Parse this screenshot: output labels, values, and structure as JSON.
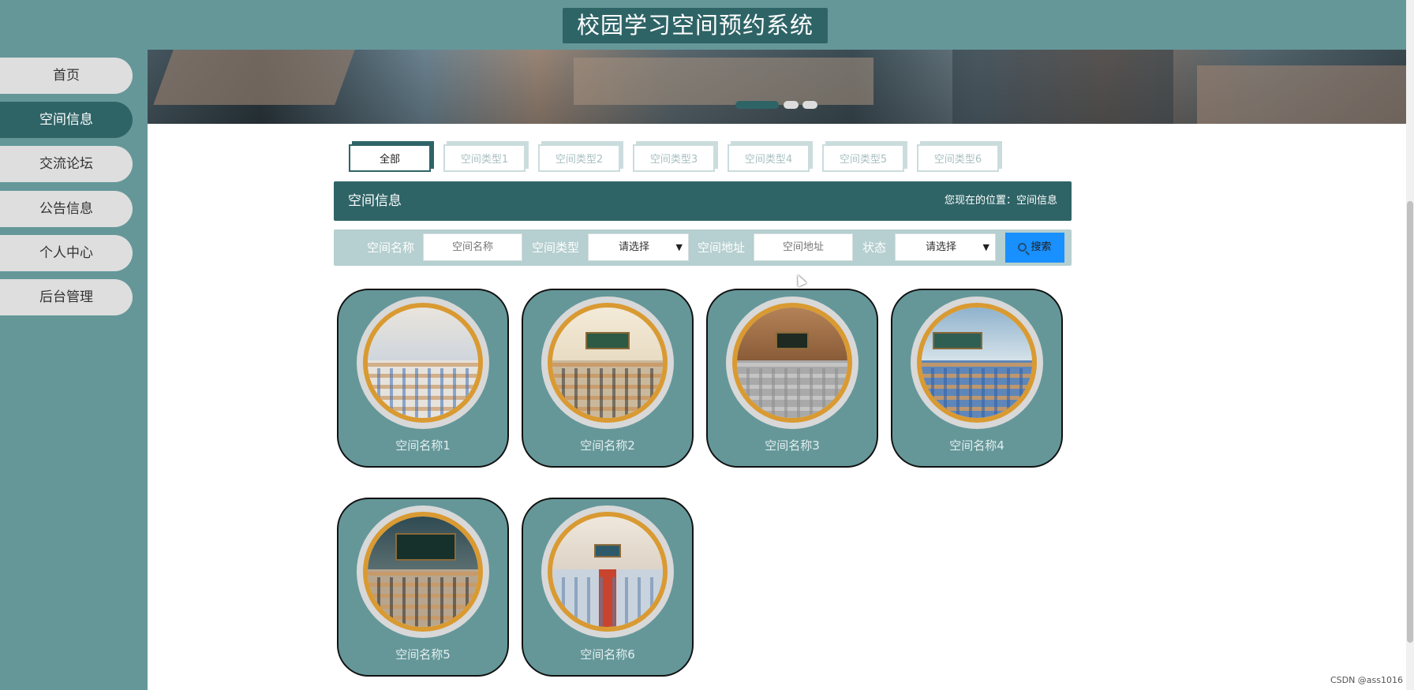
{
  "header": {
    "title": "校园学习空间预约系统"
  },
  "sidebar": {
    "items": [
      {
        "label": "首页",
        "active": false
      },
      {
        "label": "空间信息",
        "active": true
      },
      {
        "label": "交流论坛",
        "active": false
      },
      {
        "label": "公告信息",
        "active": false
      },
      {
        "label": "个人中心",
        "active": false
      },
      {
        "label": "后台管理",
        "active": false
      }
    ]
  },
  "tabs": [
    "全部",
    "空间类型1",
    "空间类型2",
    "空间类型3",
    "空间类型4",
    "空间类型5",
    "空间类型6"
  ],
  "section": {
    "title": "空间信息",
    "breadcrumb": "您现在的位置：空间信息"
  },
  "search": {
    "name_label": "空间名称",
    "name_placeholder": "空间名称",
    "type_label": "空间类型",
    "type_value": "请选择",
    "address_label": "空间地址",
    "address_placeholder": "空间地址",
    "status_label": "状态",
    "status_value": "请选择",
    "button_label": "搜索"
  },
  "cards": [
    {
      "name": "空间名称1"
    },
    {
      "name": "空间名称2"
    },
    {
      "name": "空间名称3"
    },
    {
      "name": "空间名称4"
    },
    {
      "name": "空间名称5"
    },
    {
      "name": "空间名称6"
    }
  ],
  "footer": {
    "watermark": "CSDN @ass1016"
  },
  "colors": {
    "primary": "#2f6467",
    "secondary": "#659799",
    "accent": "#1890ff",
    "ring": "#d99a32"
  }
}
